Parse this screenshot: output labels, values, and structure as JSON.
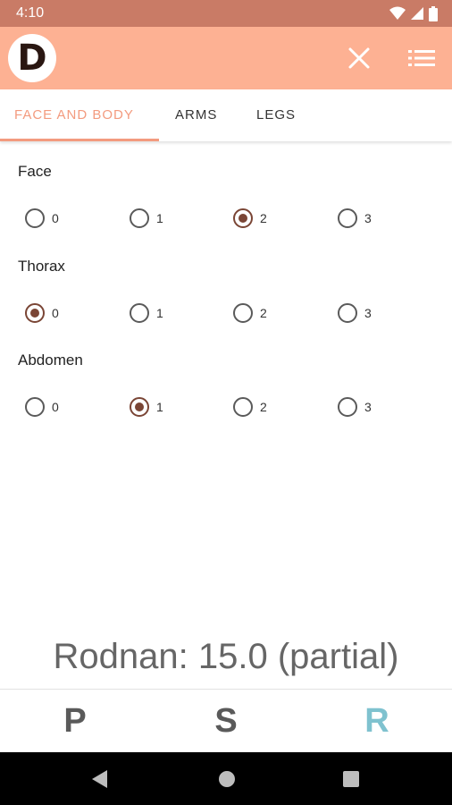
{
  "status_bar": {
    "time": "4:10"
  },
  "app_bar": {
    "logo_letter": "D"
  },
  "tabs": [
    {
      "label": "FACE AND BODY",
      "active": true
    },
    {
      "label": "ARMS",
      "active": false
    },
    {
      "label": "LEGS",
      "active": false
    }
  ],
  "sections": [
    {
      "label": "Face",
      "options": [
        "0",
        "1",
        "2",
        "3"
      ],
      "selected": "2"
    },
    {
      "label": "Thorax",
      "options": [
        "0",
        "1",
        "2",
        "3"
      ],
      "selected": "0"
    },
    {
      "label": "Abdomen",
      "options": [
        "0",
        "1",
        "2",
        "3"
      ],
      "selected": "1"
    }
  ],
  "score_text": "Rodnan: 15.0 (partial)",
  "bottom_nav": [
    {
      "label": "P",
      "active": false
    },
    {
      "label": "S",
      "active": false
    },
    {
      "label": "R",
      "active": true
    }
  ],
  "colors": {
    "status_bar": "#c97b66",
    "app_bar": "#fdb193",
    "accent": "#f39b7f",
    "radio_checked": "#7a4535",
    "active_nav": "#7fc2cf"
  }
}
